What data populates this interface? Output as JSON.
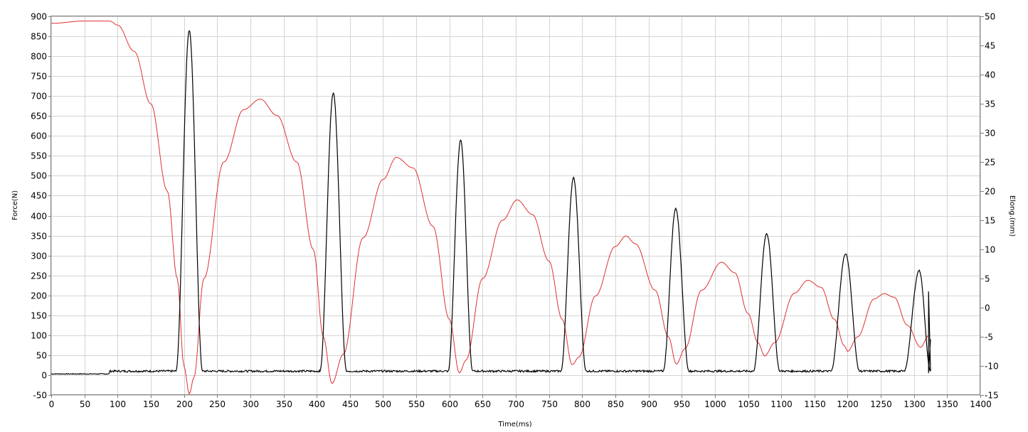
{
  "chart_data": {
    "type": "line",
    "title": "",
    "xlabel": "Time(ms)",
    "ylabel": "Force(N)",
    "y2label": "Elong.(mm)",
    "xlim": [
      0,
      1400
    ],
    "ylim": [
      -50,
      900
    ],
    "y2lim": [
      -15,
      50
    ],
    "x_ticks": [
      0,
      50,
      100,
      150,
      200,
      250,
      300,
      350,
      400,
      450,
      500,
      550,
      600,
      650,
      700,
      750,
      800,
      850,
      900,
      950,
      1000,
      1050,
      1100,
      1150,
      1200,
      1250,
      1300,
      1350,
      1400
    ],
    "y_ticks": [
      -50,
      0,
      50,
      100,
      150,
      200,
      250,
      300,
      350,
      400,
      450,
      500,
      550,
      600,
      650,
      700,
      750,
      800,
      850,
      900
    ],
    "y2_ticks": [
      -15,
      -10,
      -5,
      0,
      5,
      10,
      15,
      20,
      25,
      30,
      35,
      40,
      45,
      50
    ],
    "grid": true,
    "legend": "none",
    "series": [
      {
        "axis": "left",
        "color": "#000000",
        "baseline": 10,
        "pulses": [
          {
            "start": 188,
            "peak_t": 208,
            "end": 228,
            "peak": 865
          },
          {
            "start": 405,
            "peak_t": 425,
            "end": 445,
            "peak": 708
          },
          {
            "start": 598,
            "peak_t": 617,
            "end": 635,
            "peak": 590
          },
          {
            "start": 768,
            "peak_t": 787,
            "end": 806,
            "peak": 495
          },
          {
            "start": 922,
            "peak_t": 941,
            "end": 961,
            "peak": 418
          },
          {
            "start": 1058,
            "peak_t": 1078,
            "end": 1098,
            "peak": 355
          },
          {
            "start": 1175,
            "peak_t": 1197,
            "end": 1218,
            "peak": 305
          },
          {
            "start": 1285,
            "peak_t": 1308,
            "end": 1325,
            "peak": 262
          }
        ]
      },
      {
        "axis": "right",
        "color": "#e03030",
        "points": [
          [
            0,
            48.8
          ],
          [
            50,
            49.2
          ],
          [
            88,
            49.2
          ],
          [
            100,
            48.5
          ],
          [
            125,
            44
          ],
          [
            150,
            35
          ],
          [
            175,
            20
          ],
          [
            190,
            5
          ],
          [
            200,
            -10
          ],
          [
            208,
            -14.8
          ],
          [
            215,
            -12
          ],
          [
            230,
            5
          ],
          [
            260,
            25
          ],
          [
            290,
            34
          ],
          [
            315,
            35.8
          ],
          [
            340,
            33
          ],
          [
            370,
            25
          ],
          [
            395,
            10
          ],
          [
            410,
            -5
          ],
          [
            423,
            -13
          ],
          [
            440,
            -8
          ],
          [
            470,
            12
          ],
          [
            500,
            22
          ],
          [
            520,
            25.8
          ],
          [
            545,
            24
          ],
          [
            575,
            14
          ],
          [
            600,
            -2
          ],
          [
            615,
            -11.2
          ],
          [
            625,
            -9
          ],
          [
            650,
            5
          ],
          [
            680,
            15
          ],
          [
            702,
            18.5
          ],
          [
            725,
            16
          ],
          [
            750,
            8
          ],
          [
            770,
            -2
          ],
          [
            785,
            -9.8
          ],
          [
            795,
            -8.5
          ],
          [
            820,
            2
          ],
          [
            850,
            10.5
          ],
          [
            866,
            12.3
          ],
          [
            880,
            11
          ],
          [
            910,
            3
          ],
          [
            930,
            -5
          ],
          [
            942,
            -9.7
          ],
          [
            955,
            -7
          ],
          [
            980,
            3
          ],
          [
            1010,
            7.8
          ],
          [
            1030,
            6
          ],
          [
            1050,
            -1
          ],
          [
            1065,
            -6
          ],
          [
            1075,
            -8.3
          ],
          [
            1090,
            -6
          ],
          [
            1120,
            2.5
          ],
          [
            1140,
            4.7
          ],
          [
            1160,
            3.5
          ],
          [
            1180,
            -2
          ],
          [
            1195,
            -6.5
          ],
          [
            1200,
            -7.5
          ],
          [
            1215,
            -5
          ],
          [
            1240,
            1.5
          ],
          [
            1255,
            2.4
          ],
          [
            1270,
            1.8
          ],
          [
            1290,
            -3
          ],
          [
            1310,
            -6.8
          ],
          [
            1322,
            -4.8
          ]
        ]
      }
    ]
  }
}
